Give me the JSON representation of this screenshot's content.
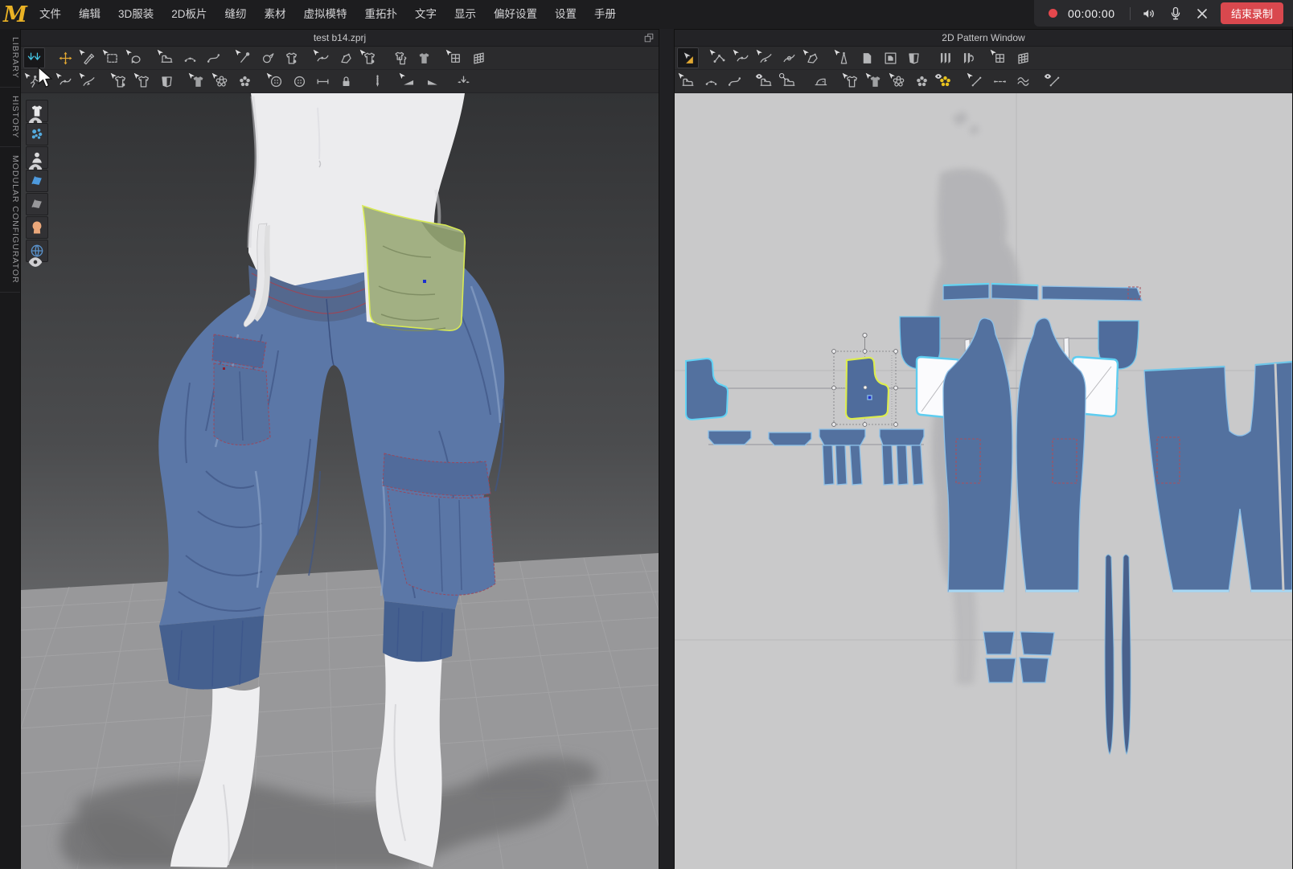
{
  "app": {
    "logo": "M"
  },
  "menu_bar": {
    "items": [
      "文件",
      "编辑",
      "3D服装",
      "2D板片",
      "缝纫",
      "素材",
      "虚拟模特",
      "重拓扑",
      "文字",
      "显示",
      "偏好设置",
      "设置",
      "手册"
    ]
  },
  "recording": {
    "time": "00:00:00",
    "stop_label": "结束录制"
  },
  "windows": {
    "viewport3d": {
      "title": "test b14.zprj"
    },
    "pattern2d": {
      "title": "2D Pattern Window"
    }
  },
  "side_tabs": [
    "LIBRARY",
    "HISTORY",
    "MODULAR CONFIGURATOR"
  ],
  "colors": {
    "accent_yellow": "#e2a832",
    "active_cyan": "#45c8e8",
    "record_red": "#e5484d",
    "stop_button_red": "#d9484e",
    "selected_piece_outline": "#dcec50",
    "piece_blue": "#53719f",
    "highlight_cyan": "#62d3f5",
    "pocket_green": "#a2b083"
  },
  "toolbars": {
    "t3d_row1": [
      {
        "name": "tool-reset-2d-arrangement",
        "icon": "downarrows",
        "color": "#45c8e8",
        "active": true
      },
      {
        "gap": true
      },
      {
        "name": "tool-select-move",
        "icon": "move",
        "color": "#e2a832"
      },
      {
        "name": "tool-select-brush",
        "icon": "pen",
        "ov": "arrow"
      },
      {
        "name": "tool-select-box",
        "icon": "marquee",
        "ov": "arrow"
      },
      {
        "name": "tool-rotate-pattern",
        "icon": "rotate",
        "ov": "arrow"
      },
      {
        "gap": true
      },
      {
        "name": "tool-sewing-machine",
        "icon": "sew",
        "ov": "arrow"
      },
      {
        "name": "tool-segment-sewing",
        "icon": "sewdots"
      },
      {
        "name": "tool-free-sewing",
        "icon": "sewcurve"
      },
      {
        "gap": true
      },
      {
        "name": "tool-pin",
        "icon": "pin",
        "ov": "arrow"
      },
      {
        "name": "tool-blower",
        "icon": "blower"
      },
      {
        "name": "tool-attach-pin",
        "icon": "shirtpin"
      },
      {
        "gap": true
      },
      {
        "name": "tool-flatten-curve",
        "icon": "curveedit",
        "ov": "arrow"
      },
      {
        "name": "tool-flatten-surface",
        "icon": "polypen"
      },
      {
        "name": "tool-tack-garment",
        "icon": "shirtpin",
        "ov": "arrow"
      },
      {
        "gap": true
      },
      {
        "name": "tool-arrange-garments",
        "icon": "shirts"
      },
      {
        "name": "tool-solidify-garment",
        "icon": "darkshirt"
      },
      {
        "gap": true
      },
      {
        "name": "tool-quad-mesh",
        "icon": "gridsm",
        "ov": "arrow"
      },
      {
        "name": "tool-quad-mesh-edit",
        "icon": "gridlg"
      }
    ],
    "t3d_row2": [
      {
        "name": "tool-avatar-pose",
        "icon": "walk",
        "ov": "arrow"
      },
      {
        "gap": true
      },
      {
        "name": "tool-edit-sewing-3d",
        "icon": "curveedit",
        "ov": "arrow"
      },
      {
        "name": "tool-edit-curvature-3d",
        "icon": "pencurve",
        "ov": "arrow"
      },
      {
        "gap": true
      },
      {
        "name": "tool-pinch",
        "icon": "shirtpin",
        "ov": "arrow"
      },
      {
        "name": "tool-sculpt",
        "icon": "shirt",
        "ov": "arrow"
      },
      {
        "name": "tool-fold-garment",
        "icon": "shield"
      },
      {
        "gap": true
      },
      {
        "name": "tool-scrub",
        "icon": "darkshirt",
        "ov": "arrow"
      },
      {
        "name": "tool-pattern-print-3d",
        "icon": "flowerO",
        "ov": "arrow"
      },
      {
        "name": "tool-pattern-print-solid-3d",
        "icon": "flower"
      },
      {
        "gap": true
      },
      {
        "name": "tool-button",
        "icon": "buttonIcon",
        "ov": "arrow"
      },
      {
        "name": "tool-buttonhole",
        "icon": "buttonIcon"
      },
      {
        "name": "tool-attach-button",
        "icon": "stitch"
      },
      {
        "name": "tool-lock-button",
        "icon": "lockbtn"
      },
      {
        "gap": true
      },
      {
        "name": "tool-zipper",
        "icon": "zipper"
      },
      {
        "gap": true
      },
      {
        "name": "tool-fold-left",
        "icon": "wedgeL",
        "ov": "arrow"
      },
      {
        "name": "tool-fold-right",
        "icon": "wedgeR"
      },
      {
        "gap": true
      },
      {
        "name": "tool-drawstring",
        "icon": "pinarrows"
      }
    ],
    "t2d_row1": [
      {
        "name": "tool-transform-pattern",
        "icon": "cursortri",
        "color": "#e2a832",
        "active": true
      },
      {
        "gap": true
      },
      {
        "name": "tool-edit-pattern",
        "icon": "nodeedit",
        "ov": "arrow"
      },
      {
        "name": "tool-edit-curvature",
        "icon": "curveedit",
        "ov": "arrow"
      },
      {
        "name": "tool-edit-curve-point",
        "icon": "pencurve",
        "ov": "arrow"
      },
      {
        "name": "tool-add-point",
        "icon": "circlecurve"
      },
      {
        "name": "tool-create-polygon",
        "icon": "polypen",
        "ov": "arrow"
      },
      {
        "gap": true
      },
      {
        "name": "tool-create-dart",
        "icon": "dart",
        "ov": "arrow"
      },
      {
        "name": "tool-pattern-copy",
        "icon": "page"
      },
      {
        "name": "tool-pattern-clone",
        "icon": "pagerect"
      },
      {
        "name": "tool-trace",
        "icon": "shield"
      },
      {
        "gap": true
      },
      {
        "name": "tool-pleats",
        "icon": "pleats"
      },
      {
        "name": "tool-pleats-fold",
        "icon": "pleatfold"
      },
      {
        "gap": true
      },
      {
        "name": "tool-quad-mesh-2d",
        "icon": "gridsm",
        "ov": "arrow"
      },
      {
        "name": "tool-quad-mesh-edit-2d",
        "icon": "gridlg"
      }
    ],
    "t2d_row2": [
      {
        "name": "tool-sewing-2d",
        "icon": "sew",
        "ov": "arrow"
      },
      {
        "name": "tool-segment-sewing-2d",
        "icon": "sewdots"
      },
      {
        "name": "tool-free-sewing-2d",
        "icon": "sewcurve"
      },
      {
        "gap": true
      },
      {
        "name": "tool-show-sewing",
        "icon": "sew",
        "ov": "eye"
      },
      {
        "name": "tool-check-sewing",
        "icon": "sew",
        "ov": "zoom"
      },
      {
        "gap": true
      },
      {
        "name": "tool-seam-taping",
        "icon": "iron"
      },
      {
        "gap": true
      },
      {
        "name": "tool-garment-fit",
        "icon": "shirt",
        "ov": "arrow"
      },
      {
        "name": "tool-scrub-2d",
        "icon": "darkshirt",
        "ov": "arrow"
      },
      {
        "name": "tool-pattern-print",
        "icon": "flowerO",
        "ov": "arrow"
      },
      {
        "name": "tool-pattern-print-solid",
        "icon": "flower"
      },
      {
        "name": "tool-show-texture",
        "icon": "flower",
        "color": "#e8c31e",
        "ov": "eye"
      },
      {
        "gap": true
      },
      {
        "name": "tool-internal-line",
        "icon": "slash",
        "ov": "arrow"
      },
      {
        "name": "tool-baseline",
        "icon": "dashline"
      },
      {
        "name": "tool-elastic",
        "icon": "waves"
      },
      {
        "gap": true
      },
      {
        "name": "tool-show-internal-lines",
        "icon": "slash",
        "ov": "eye"
      }
    ]
  },
  "view_toggles": [
    {
      "name": "toggle-show-garment",
      "icon": "shirtSolid",
      "color": "#e8e8ea",
      "badge": true
    },
    {
      "name": "toggle-show-particles",
      "icon": "spheres",
      "color": "#54aade",
      "badge": false
    },
    {
      "name": "toggle-show-avatar",
      "icon": "personbust",
      "color": "#d9d9db",
      "badge": true
    },
    {
      "name": "toggle-show-fabric",
      "icon": "fabric",
      "color": "#4e9ade",
      "badge": false
    },
    {
      "name": "toggle-show-fabric-alt",
      "icon": "fabric",
      "color": "#97979a",
      "badge": false
    },
    {
      "name": "toggle-show-head",
      "icon": "headicon",
      "color": "#eba87b",
      "badge": false
    },
    {
      "name": "toggle-show-wind",
      "icon": "globe",
      "color": "#5a92cc",
      "badge": true
    }
  ]
}
